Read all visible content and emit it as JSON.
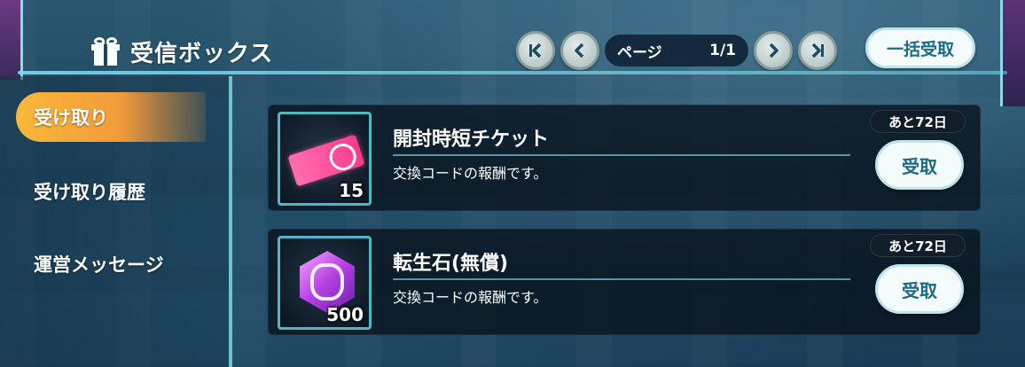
{
  "header": {
    "title": "受信ボックス",
    "title_icon": "gift-icon",
    "pager": {
      "page_label": "ページ",
      "page_value": "1/1",
      "first_icon": "first-page-icon",
      "prev_icon": "prev-page-icon",
      "next_icon": "next-page-icon",
      "last_icon": "last-page-icon"
    },
    "bulk_claim_label": "一括受取"
  },
  "sidebar": {
    "items": [
      {
        "label": "受け取り",
        "active": true
      },
      {
        "label": "受け取り履歴",
        "active": false
      },
      {
        "label": "運営メッセージ",
        "active": false
      }
    ]
  },
  "items": [
    {
      "name": "開封時短チケット",
      "description": "交換コードの報酬です。",
      "quantity": "15",
      "days_left": "あと72日",
      "claim_label": "受取",
      "icon": "ticket-icon"
    },
    {
      "name": "転生石(無償)",
      "description": "交換コードの報酬です。",
      "quantity": "500",
      "days_left": "あと72日",
      "claim_label": "受取",
      "icon": "gem-icon"
    }
  ],
  "colors": {
    "accent": "#4bb9c8",
    "active_tab": "#f29a3a",
    "button_text": "#1d6a86"
  }
}
